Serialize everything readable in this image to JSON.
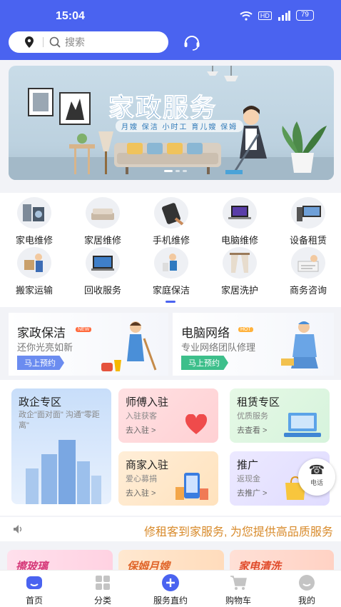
{
  "status": {
    "time": "15:04",
    "battery": "79",
    "hd": "HD"
  },
  "search": {
    "placeholder": "搜索"
  },
  "banner": {
    "title": "家政服务",
    "subtitle": "月嫂 保洁 小时工 育儿嫂 保姆"
  },
  "services": [
    {
      "label": "家电维修",
      "icon": "appliance-repair-icon"
    },
    {
      "label": "家居维修",
      "icon": "furniture-repair-icon"
    },
    {
      "label": "手机维修",
      "icon": "phone-repair-icon"
    },
    {
      "label": "电脑维修",
      "icon": "computer-repair-icon"
    },
    {
      "label": "设备租赁",
      "icon": "equipment-rental-icon"
    },
    {
      "label": "搬家运输",
      "icon": "moving-icon"
    },
    {
      "label": "回收服务",
      "icon": "recycling-icon"
    },
    {
      "label": "家庭保洁",
      "icon": "cleaning-icon"
    },
    {
      "label": "家居洗护",
      "icon": "home-care-icon"
    },
    {
      "label": "商务咨询",
      "icon": "consulting-icon"
    }
  ],
  "promos": [
    {
      "title": "家政保洁",
      "tag": "NEW",
      "sub": "还你光亮如新",
      "button": "马上预约",
      "color": "#6b8cf0"
    },
    {
      "title": "电脑网络",
      "tag": "HOT",
      "sub": "专业网络团队修理",
      "button": "马上预约",
      "color": "#3dbf8b"
    }
  ],
  "cards": {
    "gov": {
      "title": "政企专区",
      "sub": "政企\"面对面\" 沟通\"零距离\""
    },
    "master": {
      "title": "师傅入驻",
      "sub": "入驻获客",
      "link": "去入驻 >"
    },
    "rent": {
      "title": "租赁专区",
      "sub": "优质服务",
      "link": "去查看 >"
    },
    "merchant": {
      "title": "商家入驻",
      "sub": "爱心募捐",
      "link": "去入驻 >"
    },
    "promote": {
      "title": "推广",
      "sub": "返现金",
      "link": "去推广 >"
    }
  },
  "phone_button": {
    "label": "电话"
  },
  "notice": {
    "text": "修租客到家服务, 为您提供高品质服务"
  },
  "bottom_cards": [
    {
      "label": "擦玻璃"
    },
    {
      "label": "保姆月嫂"
    },
    {
      "label": "家电清洗"
    }
  ],
  "tabs": [
    {
      "label": "首页",
      "icon": "home-icon"
    },
    {
      "label": "分类",
      "icon": "category-icon"
    },
    {
      "label": "服务直约",
      "icon": "plus-icon"
    },
    {
      "label": "购物车",
      "icon": "cart-icon"
    },
    {
      "label": "我的",
      "icon": "profile-icon"
    }
  ],
  "colors": {
    "primary": "#4a63f0",
    "notice": "#d88a2a"
  }
}
